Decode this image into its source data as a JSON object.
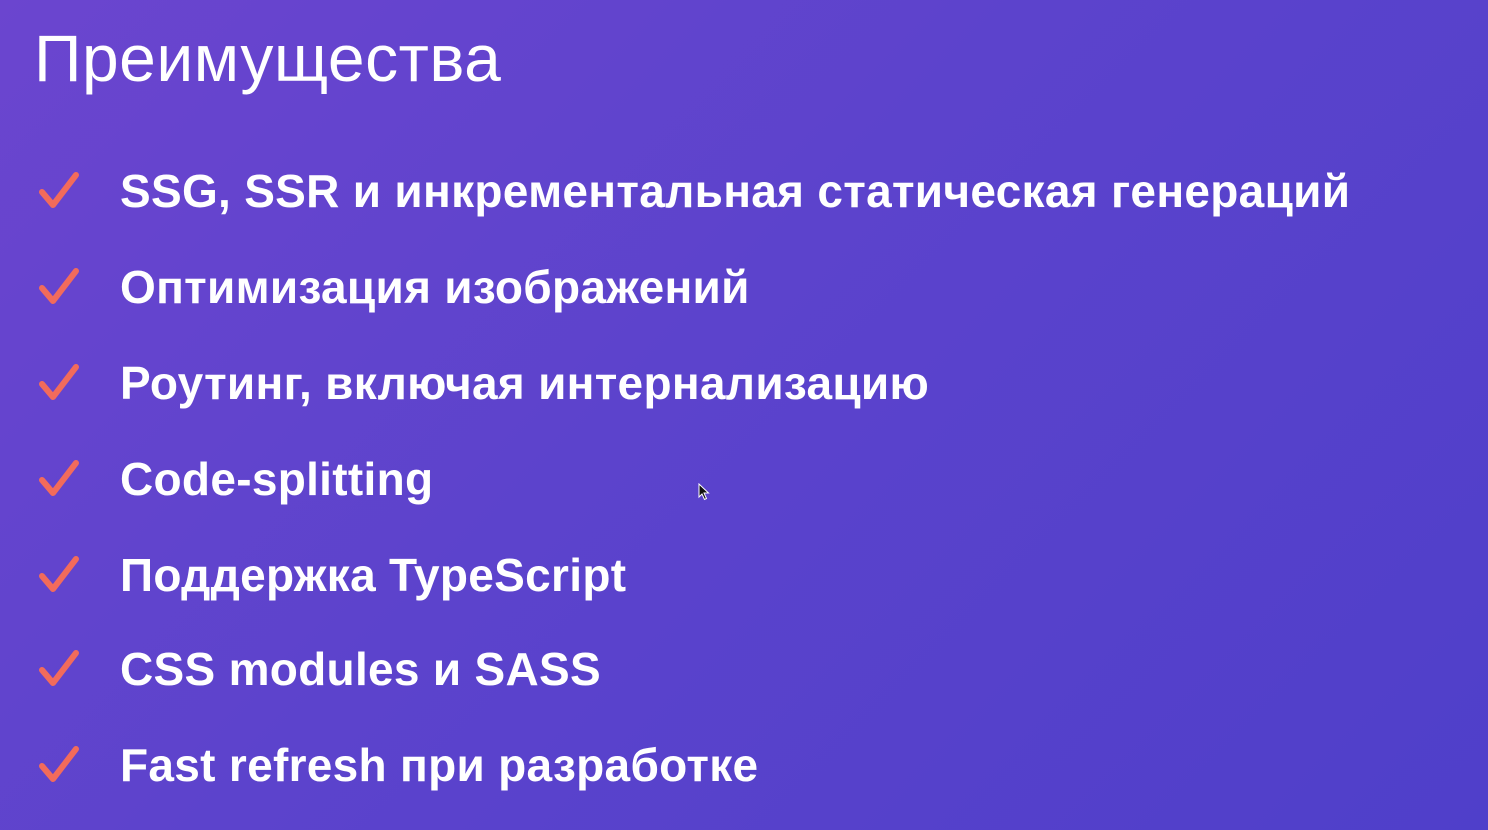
{
  "slide": {
    "title": "Преимущества",
    "accent_color": "#f26b5b",
    "items": [
      {
        "label": "SSG, SSR и инкрементальная статическая генераций",
        "icon": "check-icon"
      },
      {
        "label": "Оптимизация изображений",
        "icon": "check-icon"
      },
      {
        "label": "Роутинг, включая интернализацию",
        "icon": "check-icon"
      },
      {
        "label": "Code-splitting",
        "icon": "check-icon"
      },
      {
        "label": "Поддержка TypeScript",
        "icon": "check-icon"
      },
      {
        "label": "CSS modules и SASS",
        "icon": "check-icon"
      },
      {
        "label": "Fast refresh при разработке",
        "icon": "check-icon"
      }
    ]
  }
}
